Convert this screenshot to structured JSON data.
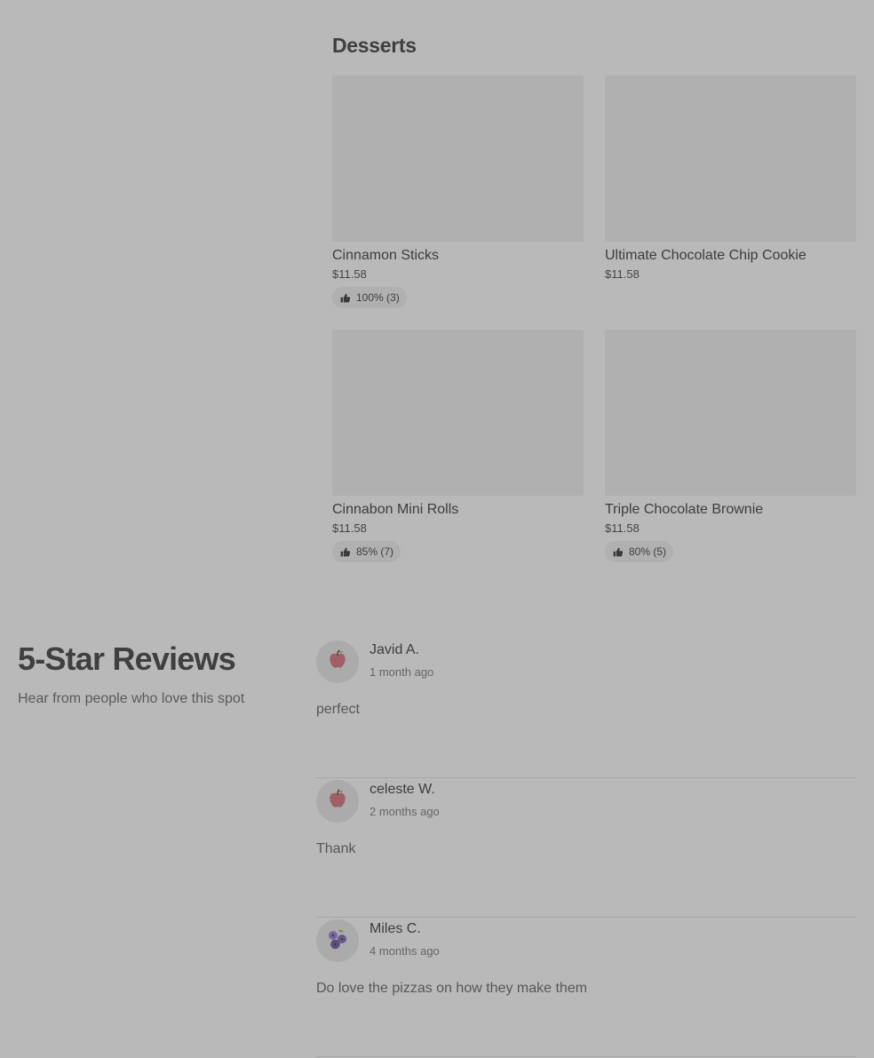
{
  "desserts": {
    "title": "Desserts",
    "items": [
      {
        "name": "Cinnamon Sticks",
        "price": "$11.58",
        "rating": "100% (3)"
      },
      {
        "name": "Ultimate Chocolate Chip Cookie",
        "price": "$11.58",
        "rating": ""
      },
      {
        "name": "Cinnabon Mini Rolls",
        "price": "$11.58",
        "rating": "85% (7)"
      },
      {
        "name": "Triple Chocolate Brownie",
        "price": "$11.58",
        "rating": "80% (5)"
      }
    ]
  },
  "reviews": {
    "heading": "5-Star Reviews",
    "subheading": "Hear from people who love this spot",
    "items": [
      {
        "name": "Javid A.",
        "date": "1 month ago",
        "text": "perfect",
        "avatar_icon": "apple-icon"
      },
      {
        "name": "celeste W.",
        "date": "2 months ago",
        "text": "Thank",
        "avatar_icon": "apple-icon"
      },
      {
        "name": "Miles C.",
        "date": "4 months ago",
        "text": "Do love the pizzas on how they make them",
        "avatar_icon": "blueberry-icon"
      }
    ]
  },
  "colors": {
    "background": "#b9b9b9",
    "placeholder": "#b0b0b0",
    "apple": "#a05f66",
    "blueberry": "#6b5a86",
    "leaf": "#6d8f4f"
  }
}
